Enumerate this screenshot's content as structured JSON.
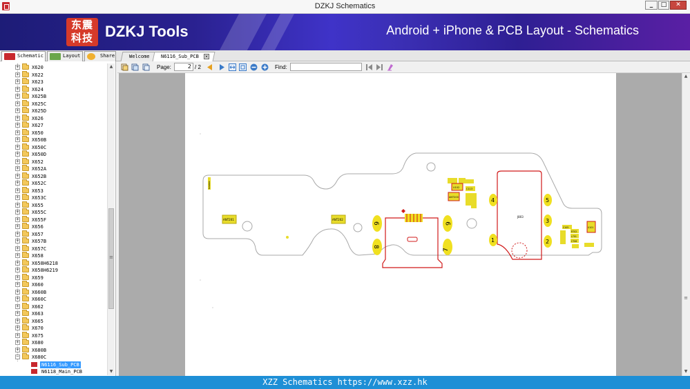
{
  "window": {
    "title": "DZKJ Schematics"
  },
  "banner": {
    "logo_text": "东震科技",
    "brand": "DZKJ Tools",
    "tagline": "Android + iPhone & PCB Layout - Schematics"
  },
  "left_tabs": [
    {
      "label": "Schematic",
      "icon": "pdf-icon"
    },
    {
      "label": "Layout",
      "icon": "pads-icon"
    },
    {
      "label": "Share",
      "icon": "share-icon"
    }
  ],
  "doc_tabs": [
    {
      "label": "Welcome",
      "active": false
    },
    {
      "label": "N6116_Sub_PCB",
      "active": true,
      "closable": true
    }
  ],
  "toolbar": {
    "page_label": "Page:",
    "page_value": "2",
    "page_total": "/ 2",
    "find_label": "Find:",
    "find_value": ""
  },
  "tree": {
    "folders": [
      "X620",
      "X622",
      "X623",
      "X624",
      "X625B",
      "X625C",
      "X625D",
      "X626",
      "X627",
      "X650",
      "X650B",
      "X650C",
      "X650D",
      "X652",
      "X652A",
      "X652B",
      "X652C",
      "X653",
      "X653C",
      "X655",
      "X655C",
      "X655F",
      "X656",
      "X657",
      "X657B",
      "X657C",
      "X658",
      "X658H6218",
      "X658H6219",
      "X659",
      "X660",
      "X660B",
      "X660C",
      "X662",
      "X663",
      "X665",
      "X670",
      "X675",
      "X680",
      "X680B",
      "X680C"
    ],
    "expanded_folder": "X680C",
    "children": [
      {
        "label": "N6116_Sub_PCB",
        "selected": true
      },
      {
        "label": "N6118_Main_PCB",
        "selected": false
      }
    ]
  },
  "schematic": {
    "component_labels": [
      "ANT201",
      "ANT202",
      "MAIN00",
      "J803",
      "U102",
      "C113",
      "ANT200",
      "C105",
      "R702",
      "L701",
      "C706",
      "U101",
      "L400",
      "E4",
      "E3"
    ],
    "pin_numbers": [
      "6",
      "8",
      "9",
      "7",
      "4",
      "5",
      "3",
      "1",
      "2"
    ],
    "colors": {
      "outline": "#a8a8a8",
      "component": "#e8dc2a",
      "connector": "#d01818"
    }
  },
  "status": {
    "text": "XZZ Schematics https://www.xzz.hk"
  }
}
